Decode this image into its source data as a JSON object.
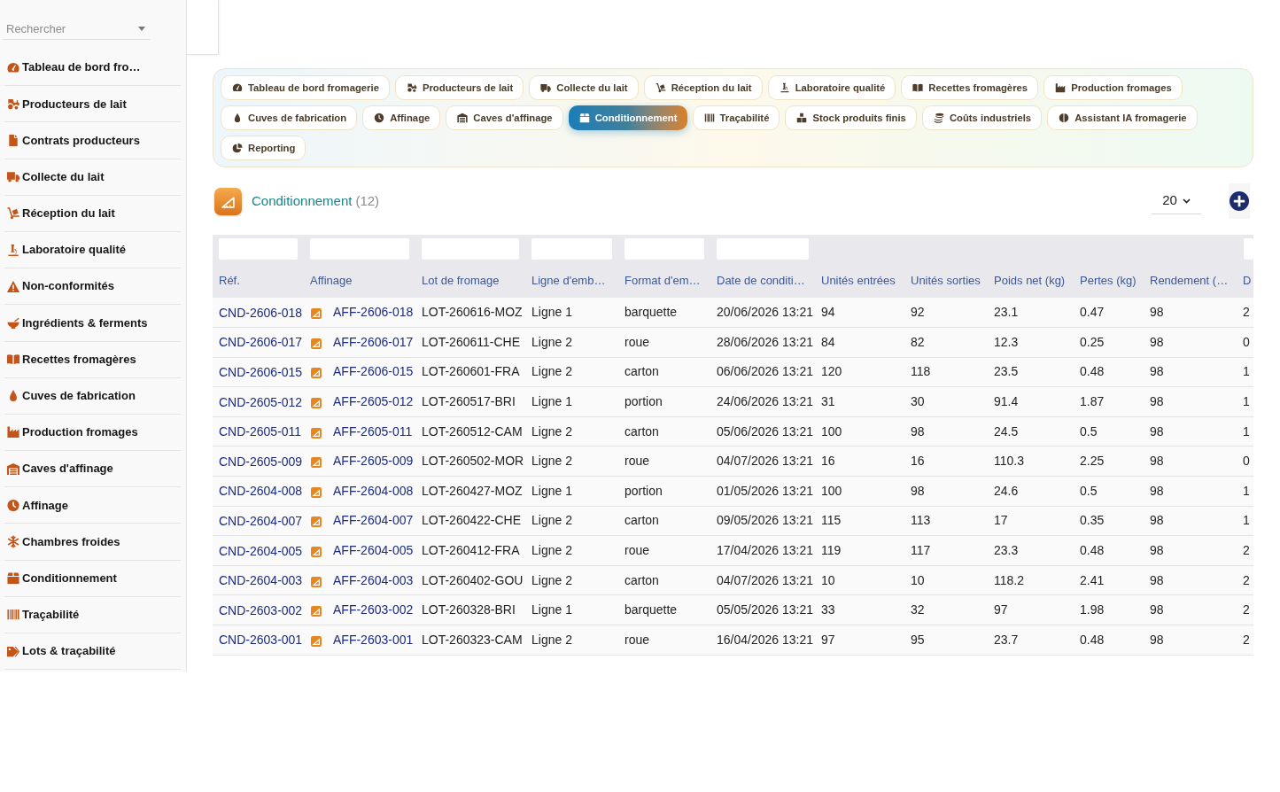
{
  "sidebar": {
    "search": {
      "placeholder": "Rechercher"
    },
    "items": [
      {
        "label": "Tableau de bord fro…"
      },
      {
        "label": "Producteurs de lait"
      },
      {
        "label": "Contrats producteurs"
      },
      {
        "label": "Collecte du lait"
      },
      {
        "label": "Réception du lait"
      },
      {
        "label": "Laboratoire qualité"
      },
      {
        "label": "Non-conformités"
      },
      {
        "label": "Ingrédients & ferments"
      },
      {
        "label": "Recettes fromagères"
      },
      {
        "label": "Cuves de fabrication"
      },
      {
        "label": "Production fromages"
      },
      {
        "label": "Caves d'affinage"
      },
      {
        "label": "Affinage"
      },
      {
        "label": "Chambres froides"
      },
      {
        "label": "Conditionnement"
      },
      {
        "label": "Traçabilité"
      },
      {
        "label": "Lots & traçabilité"
      }
    ]
  },
  "tabs": [
    {
      "label": "Tableau de bord fromagerie",
      "selected": false
    },
    {
      "label": "Producteurs de lait",
      "selected": false
    },
    {
      "label": "Collecte du lait",
      "selected": false
    },
    {
      "label": "Réception du lait",
      "selected": false
    },
    {
      "label": "Laboratoire qualité",
      "selected": false
    },
    {
      "label": "Recettes fromagères",
      "selected": false
    },
    {
      "label": "Production fromages",
      "selected": false
    },
    {
      "label": "Cuves de fabrication",
      "selected": false
    },
    {
      "label": "Affinage",
      "selected": false
    },
    {
      "label": "Caves d'affinage",
      "selected": false
    },
    {
      "label": "Conditionnement",
      "selected": true
    },
    {
      "label": "Traçabilité",
      "selected": false
    },
    {
      "label": "Stock produits finis",
      "selected": false
    },
    {
      "label": "Coûts industriels",
      "selected": false
    },
    {
      "label": "Assistant IA fromagerie",
      "selected": false
    },
    {
      "label": "Reporting",
      "selected": false
    }
  ],
  "list": {
    "title": "Conditionnement",
    "count": "(12)",
    "page_size": "20"
  },
  "table": {
    "columns": [
      {
        "label": "Réf.",
        "kind": "link",
        "filter": true
      },
      {
        "label": "Affinage",
        "kind": "icon_link",
        "filter": true
      },
      {
        "label": "Lot de fromage",
        "kind": "text",
        "filter": true
      },
      {
        "label": "Ligne d'emb…",
        "kind": "text",
        "filter": true
      },
      {
        "label": "Format d'em…",
        "kind": "text",
        "filter": true
      },
      {
        "label": "Date de conditi…",
        "kind": "text",
        "filter": true
      },
      {
        "label": "Unités entrées",
        "kind": "text",
        "filter": false
      },
      {
        "label": "Unités sorties",
        "kind": "text",
        "filter": false
      },
      {
        "label": "Poids net (kg)",
        "kind": "text",
        "filter": false
      },
      {
        "label": "Pertes (kg)",
        "kind": "text",
        "filter": false
      },
      {
        "label": "Rendement (…",
        "kind": "text",
        "filter": false
      },
      {
        "label": "D",
        "kind": "text",
        "filter": true
      }
    ],
    "rows": [
      {
        "cells": [
          "CND-2606-018",
          "AFF-2606-018",
          "LOT-260616-MOZ",
          "Ligne 1",
          "barquette",
          "20/06/2026 13:21",
          "94",
          "92",
          "23.1",
          "0.47",
          "98",
          "2"
        ]
      },
      {
        "cells": [
          "CND-2606-017",
          "AFF-2606-017",
          "LOT-260611-CHE",
          "Ligne 2",
          "roue",
          "28/06/2026 13:21",
          "84",
          "82",
          "12.3",
          "0.25",
          "98",
          "0"
        ]
      },
      {
        "cells": [
          "CND-2606-015",
          "AFF-2606-015",
          "LOT-260601-FRA",
          "Ligne 2",
          "carton",
          "06/06/2026 13:21",
          "120",
          "118",
          "23.5",
          "0.48",
          "98",
          "1"
        ]
      },
      {
        "cells": [
          "CND-2605-012",
          "AFF-2605-012",
          "LOT-260517-BRI",
          "Ligne 1",
          "portion",
          "24/06/2026 13:21",
          "31",
          "30",
          "91.4",
          "1.87",
          "98",
          "1"
        ]
      },
      {
        "cells": [
          "CND-2605-011",
          "AFF-2605-011",
          "LOT-260512-CAM",
          "Ligne 2",
          "carton",
          "05/06/2026 13:21",
          "100",
          "98",
          "24.5",
          "0.5",
          "98",
          "1"
        ]
      },
      {
        "cells": [
          "CND-2605-009",
          "AFF-2605-009",
          "LOT-260502-MOR",
          "Ligne 2",
          "roue",
          "04/07/2026 13:21",
          "16",
          "16",
          "110.3",
          "2.25",
          "98",
          "0"
        ]
      },
      {
        "cells": [
          "CND-2604-008",
          "AFF-2604-008",
          "LOT-260427-MOZ",
          "Ligne 1",
          "portion",
          "01/05/2026 13:21",
          "100",
          "98",
          "24.6",
          "0.5",
          "98",
          "1"
        ]
      },
      {
        "cells": [
          "CND-2604-007",
          "AFF-2604-007",
          "LOT-260422-CHE",
          "Ligne 2",
          "carton",
          "09/05/2026 13:21",
          "115",
          "113",
          "17",
          "0.35",
          "98",
          "1"
        ]
      },
      {
        "cells": [
          "CND-2604-005",
          "AFF-2604-005",
          "LOT-260412-FRA",
          "Ligne 2",
          "roue",
          "17/04/2026 13:21",
          "119",
          "117",
          "23.3",
          "0.48",
          "98",
          "2"
        ]
      },
      {
        "cells": [
          "CND-2604-003",
          "AFF-2604-003",
          "LOT-260402-GOU",
          "Ligne 2",
          "carton",
          "04/07/2026 13:21",
          "10",
          "10",
          "118.2",
          "2.41",
          "98",
          "2"
        ]
      },
      {
        "cells": [
          "CND-2603-002",
          "AFF-2603-002",
          "LOT-260328-BRI",
          "Ligne 1",
          "barquette",
          "05/05/2026 13:21",
          "33",
          "32",
          "97",
          "1.98",
          "98",
          "2"
        ]
      },
      {
        "cells": [
          "CND-2603-001",
          "AFF-2603-001",
          "LOT-260323-CAM",
          "Ligne 2",
          "roue",
          "16/04/2026 13:21",
          "97",
          "95",
          "23.7",
          "0.48",
          "98",
          "2"
        ]
      }
    ]
  }
}
